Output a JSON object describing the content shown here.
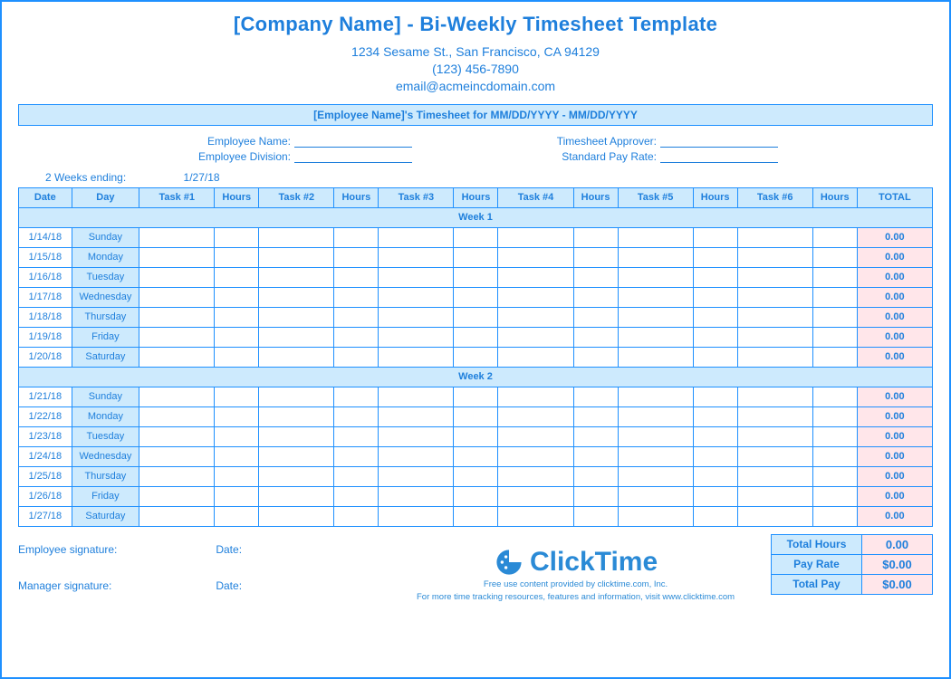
{
  "header": {
    "title": "[Company Name] - Bi-Weekly Timesheet Template",
    "street": "1234 Sesame St., San Francisco, CA 94129",
    "phone": "(123) 456-7890",
    "email": "email@acmeincdomain.com"
  },
  "banner": "[Employee Name]'s Timesheet for MM/DD/YYYY - MM/DD/YYYY",
  "meta": {
    "left": {
      "employee_name": "Employee Name:",
      "employee_division": "Employee Division:"
    },
    "right": {
      "timesheet_approver": "Timesheet Approver:",
      "standard_pay_rate": "Standard Pay Rate:"
    }
  },
  "ending": {
    "label": "2 Weeks ending:",
    "value": "1/27/18"
  },
  "columns": {
    "date": "Date",
    "day": "Day",
    "t1": "Task #1",
    "h1": "Hours",
    "t2": "Task #2",
    "h2": "Hours",
    "t3": "Task #3",
    "h3": "Hours",
    "t4": "Task #4",
    "h4": "Hours",
    "t5": "Task #5",
    "h5": "Hours",
    "t6": "Task #6",
    "h6": "Hours",
    "total": "TOTAL"
  },
  "week1_label": "Week 1",
  "week2_label": "Week 2",
  "week1": [
    {
      "date": "1/14/18",
      "day": "Sunday",
      "total": "0.00"
    },
    {
      "date": "1/15/18",
      "day": "Monday",
      "total": "0.00"
    },
    {
      "date": "1/16/18",
      "day": "Tuesday",
      "total": "0.00"
    },
    {
      "date": "1/17/18",
      "day": "Wednesday",
      "total": "0.00"
    },
    {
      "date": "1/18/18",
      "day": "Thursday",
      "total": "0.00"
    },
    {
      "date": "1/19/18",
      "day": "Friday",
      "total": "0.00"
    },
    {
      "date": "1/20/18",
      "day": "Saturday",
      "total": "0.00"
    }
  ],
  "week2": [
    {
      "date": "1/21/18",
      "day": "Sunday",
      "total": "0.00"
    },
    {
      "date": "1/22/18",
      "day": "Monday",
      "total": "0.00"
    },
    {
      "date": "1/23/18",
      "day": "Tuesday",
      "total": "0.00"
    },
    {
      "date": "1/24/18",
      "day": "Wednesday",
      "total": "0.00"
    },
    {
      "date": "1/25/18",
      "day": "Thursday",
      "total": "0.00"
    },
    {
      "date": "1/26/18",
      "day": "Friday",
      "total": "0.00"
    },
    {
      "date": "1/27/18",
      "day": "Saturday",
      "total": "0.00"
    }
  ],
  "sig": {
    "employee": "Employee signature:",
    "manager": "Manager signature:",
    "date": "Date:"
  },
  "brand": {
    "name": "ClickTime",
    "line1": "Free use content provided by clicktime.com, Inc.",
    "line2": "For more time tracking resources, features and information, visit www.clicktime.com"
  },
  "summary": {
    "total_hours_k": "Total Hours",
    "total_hours_v": "0.00",
    "pay_rate_k": "Pay Rate",
    "pay_rate_v": "$0.00",
    "total_pay_k": "Total Pay",
    "total_pay_v": "$0.00"
  }
}
